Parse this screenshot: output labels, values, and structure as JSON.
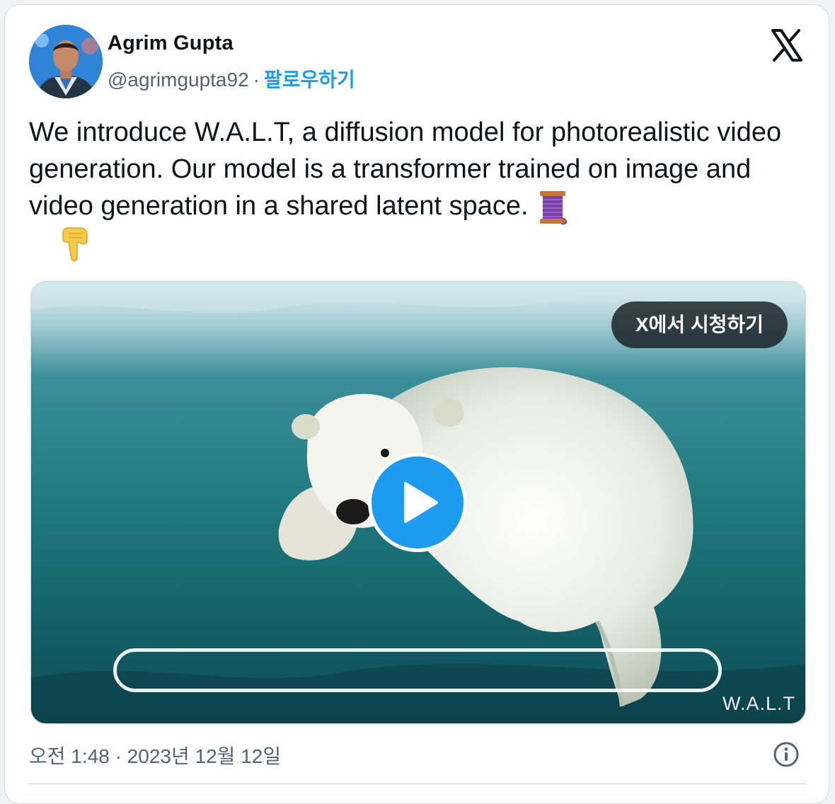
{
  "author": {
    "name": "Agrim Gupta",
    "handle": "@agrimgupta92",
    "separator": "·",
    "follow_label": "팔로우하기"
  },
  "tweet": {
    "text": "We introduce W.A.L.T, a diffusion model for photorealistic video generation. Our model is a transformer trained on image and video generation in a shared latent space.",
    "emojis": [
      "thread-icon",
      "pointing-down-icon"
    ]
  },
  "media": {
    "watch_label": "X에서 시청하기",
    "watermark": "W.A.L.T",
    "play_icon": "play-icon"
  },
  "footer": {
    "timestamp": "오전 1:48 · 2023년 12월 12일",
    "info_icon": "info-icon"
  },
  "colors": {
    "accent": "#1d9bf0",
    "text_primary": "#0f1419",
    "text_secondary": "#536471",
    "border": "#cfd9de"
  }
}
